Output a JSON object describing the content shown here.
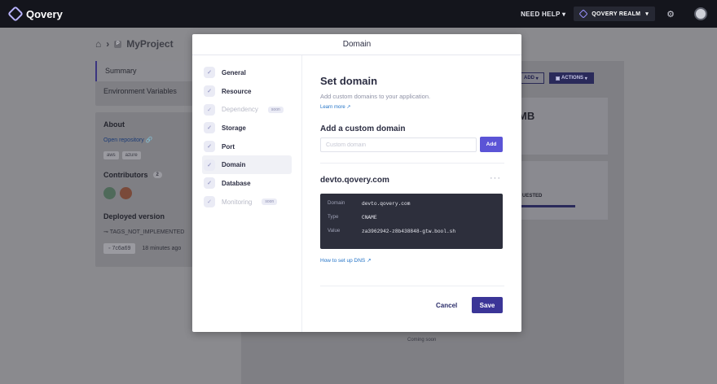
{
  "topnav": {
    "brand": "Qovery",
    "need_help": "NEED HELP",
    "realm": "QOVERY REALM"
  },
  "background": {
    "breadcrumb_project_badge": "P",
    "breadcrumb_project": "MyProject",
    "nav": [
      "Summary",
      "Environment Variables"
    ],
    "about_title": "About",
    "open_repository": "Open repository",
    "tags": [
      "aws",
      "azure"
    ],
    "contributors_label": "Contributors",
    "contributors_count": "2",
    "deployed_version_label": "Deployed version",
    "tag_name": "TAGS_NOT_IMPLEMENTED",
    "commit": "7c6a69",
    "commit_time": "18 minutes ago",
    "add_btn": "ADD",
    "actions_btn": "ACTIONS",
    "mb_text": "MB",
    "requested_text": "UESTED",
    "coming_soon": "Coming soon"
  },
  "modal": {
    "title": "Domain",
    "sidebar": [
      {
        "label": "General",
        "disabled": false,
        "active": false,
        "soon": ""
      },
      {
        "label": "Resource",
        "disabled": false,
        "active": false,
        "soon": ""
      },
      {
        "label": "Dependency",
        "disabled": true,
        "active": false,
        "soon": "soon"
      },
      {
        "label": "Storage",
        "disabled": false,
        "active": false,
        "soon": ""
      },
      {
        "label": "Port",
        "disabled": false,
        "active": false,
        "soon": ""
      },
      {
        "label": "Domain",
        "disabled": false,
        "active": true,
        "soon": ""
      },
      {
        "label": "Database",
        "disabled": false,
        "active": false,
        "soon": ""
      },
      {
        "label": "Monitoring",
        "disabled": true,
        "active": false,
        "soon": "soon"
      }
    ],
    "set_domain_title": "Set domain",
    "set_domain_sub": "Add custom domains to your application.",
    "learn_more": "Learn more",
    "add_custom_title": "Add a custom domain",
    "input_placeholder": "Custom domain",
    "input_value": "",
    "add_btn": "Add",
    "domain_name": "devto.qovery.com",
    "record": {
      "domain_label": "Domain",
      "domain_value": "devto.qovery.com",
      "type_label": "Type",
      "type_value": "CNAME",
      "value_label": "Value",
      "value_value": "za3962942-z8b438848-gtw.bool.sh"
    },
    "how_to_dns": "How to set up DNS",
    "cancel_btn": "Cancel",
    "save_btn": "Save"
  }
}
